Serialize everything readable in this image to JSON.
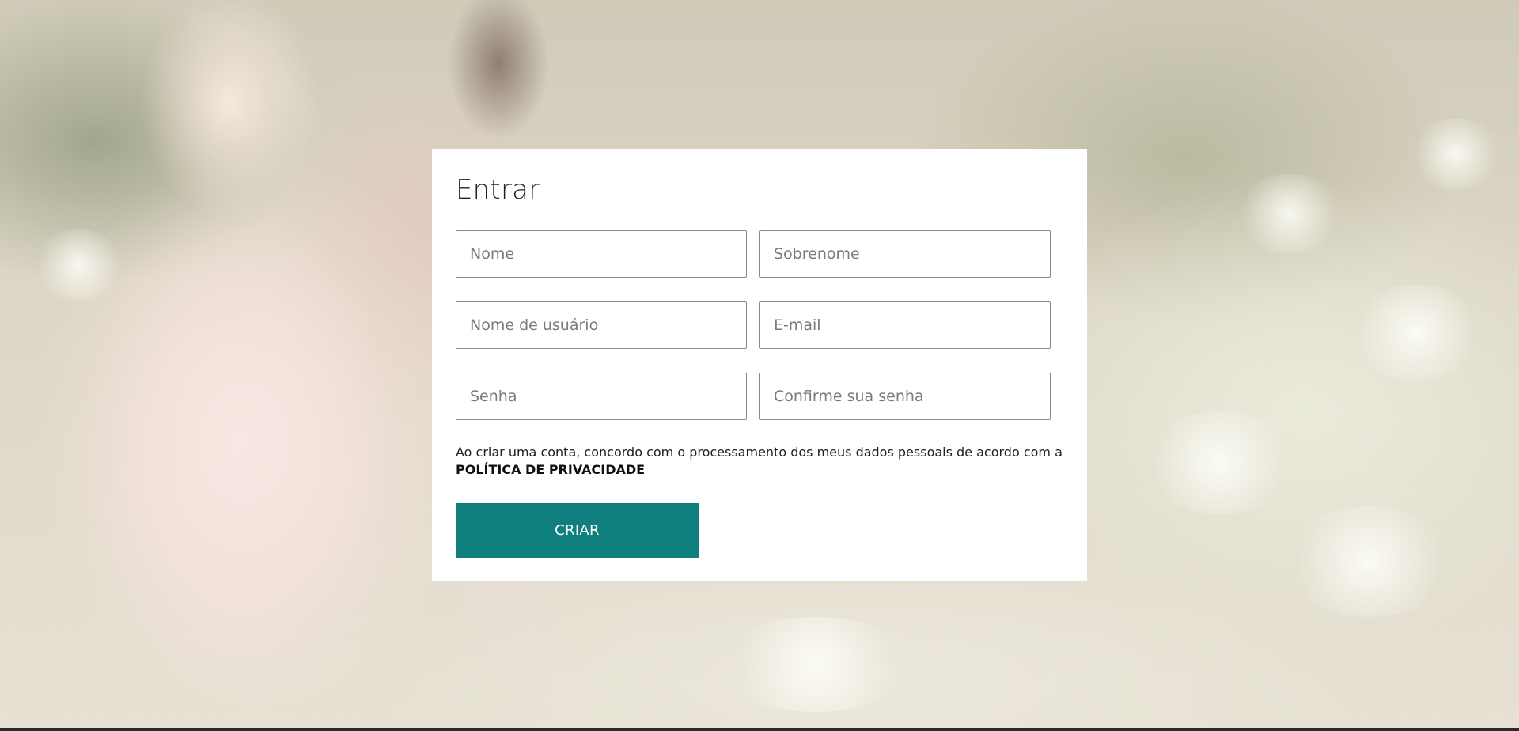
{
  "colors": {
    "accent": "#0f7f7e",
    "card_background": "#ffffff",
    "field_border": "#8a8a8a",
    "text": "#1f1f1f"
  },
  "form": {
    "title": "Entrar",
    "fields": {
      "first_name": {
        "placeholder": "Nome",
        "value": ""
      },
      "last_name": {
        "placeholder": "Sobrenome",
        "value": ""
      },
      "username": {
        "placeholder": "Nome de usuário",
        "value": ""
      },
      "email": {
        "placeholder": "E-mail",
        "value": ""
      },
      "password": {
        "placeholder": "Senha",
        "value": ""
      },
      "confirm_password": {
        "placeholder": "Confirme sua senha",
        "value": ""
      }
    },
    "consent_text": "Ao criar uma conta, concordo com o processamento dos meus dados pessoais de acordo com a",
    "privacy_link": "POLÍTICA DE PRIVACIDADE",
    "submit_label": "CRIAR"
  }
}
